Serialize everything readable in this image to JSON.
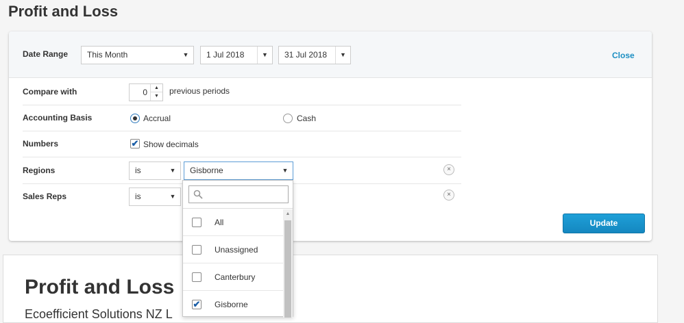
{
  "page": {
    "title": "Profit and Loss"
  },
  "filters": {
    "date_range": {
      "label": "Date Range",
      "period": "This Month",
      "from": "1 Jul 2018",
      "to": "31 Jul 2018",
      "close_label": "Close"
    },
    "compare": {
      "label": "Compare with",
      "value": "0",
      "suffix": "previous periods"
    },
    "accounting_basis": {
      "label": "Accounting Basis",
      "options": [
        "Accrual",
        "Cash"
      ],
      "selected": "Accrual"
    },
    "numbers": {
      "label": "Numbers",
      "show_decimals_label": "Show decimals",
      "show_decimals": true
    },
    "regions": {
      "label": "Regions",
      "operator": "is",
      "value": "Gisborne"
    },
    "sales_reps": {
      "label": "Sales Reps",
      "operator": "is"
    },
    "update_label": "Update"
  },
  "dropdown": {
    "search_placeholder": "",
    "items": [
      {
        "label": "All",
        "checked": false
      },
      {
        "label": "Unassigned",
        "checked": false
      },
      {
        "label": "Canterbury",
        "checked": false
      },
      {
        "label": "Gisborne",
        "checked": true
      }
    ]
  },
  "report": {
    "title": "Profit and Loss",
    "subtitle": "Ecoefficient Solutions NZ L"
  },
  "colors": {
    "accent": "#1c8fc3",
    "button": "#1487c0"
  }
}
